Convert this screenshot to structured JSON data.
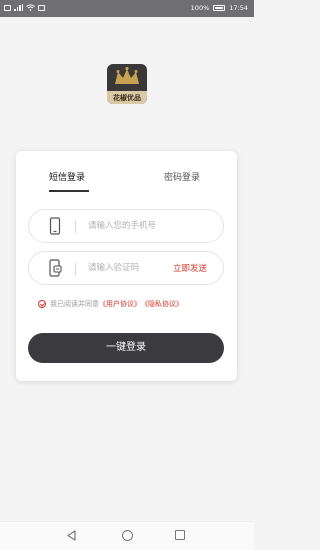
{
  "status_bar": {
    "battery_percent": "100%",
    "time": "17:54"
  },
  "logo": {
    "text": "花椒优品"
  },
  "login": {
    "tabs": [
      {
        "label": "短信登录",
        "active": true
      },
      {
        "label": "密码登录",
        "active": false
      }
    ],
    "phone_placeholder": "请输入您的手机号",
    "code_placeholder": "请输入验证码",
    "send_code_label": "立即发送",
    "agreement": {
      "prefix": "我已阅读并同意",
      "user_agreement": "《用户协议》",
      "privacy_agreement": "《隐私协议》"
    },
    "submit_label": "一键登录"
  },
  "colors": {
    "accent": "#d2352b",
    "button": "#3b3a3f",
    "status_bar": "#6f6f73"
  }
}
